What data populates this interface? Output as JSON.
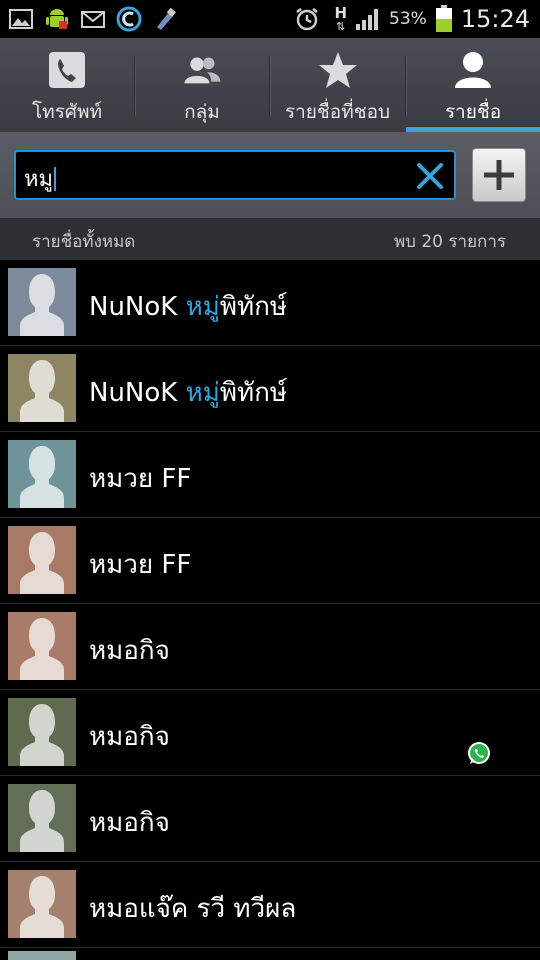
{
  "status_bar": {
    "network_type": "H",
    "battery_percent": "53%",
    "time": "15:24",
    "icons": [
      "image-icon",
      "android-icon",
      "mail-icon",
      "app-icon",
      "tool-icon",
      "alarm-icon",
      "data-arrows-icon",
      "signal-icon",
      "battery-icon"
    ]
  },
  "tabs": [
    {
      "label": "โทรศัพท์",
      "icon": "phone-icon",
      "active": false
    },
    {
      "label": "กลุ่ม",
      "icon": "group-icon",
      "active": false
    },
    {
      "label": "รายชื่อที่ชอบ",
      "icon": "star-icon",
      "active": false
    },
    {
      "label": "รายชื่อ",
      "icon": "person-icon",
      "active": true
    }
  ],
  "search": {
    "value": "หมู"
  },
  "section": {
    "title": "รายชื่อทั้งหมด",
    "count": "พบ 20 รายการ"
  },
  "contacts": [
    {
      "pre": "NuNoK ",
      "match": "หมู่",
      "post": "พิทักษ์",
      "avatar_color": "#7c8a9c"
    },
    {
      "pre": "NuNoK ",
      "match": "หมู่",
      "post": "พิทักษ์",
      "avatar_color": "#8e8562"
    },
    {
      "pre": "หมวย FF",
      "match": "",
      "post": "",
      "avatar_color": "#6e9499"
    },
    {
      "pre": "หมวย FF",
      "match": "",
      "post": "",
      "avatar_color": "#a77a66"
    },
    {
      "pre": "หมอกิจ",
      "match": "",
      "post": "",
      "avatar_color": "#a97c6a"
    },
    {
      "pre": "หมอกิจ",
      "match": "",
      "post": "",
      "avatar_color": "#5f6a4e"
    },
    {
      "pre": "หมอกิจ",
      "match": "",
      "post": "",
      "avatar_color": "#636e57"
    },
    {
      "pre": "หมอแจ๊ค รวี ทวีผล",
      "match": "",
      "post": "",
      "avatar_color": "#a5806d"
    }
  ],
  "colors": {
    "accent": "#35a5dd",
    "battery": "#9ccf2b"
  }
}
